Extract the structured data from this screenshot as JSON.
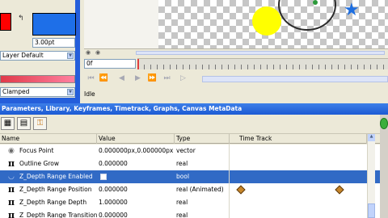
{
  "toolbox": {
    "outline_color": "#ff0000",
    "fill_color": "#1e6fe8",
    "swap_glyph": "↰",
    "width_value": "3.00pt",
    "layer_default": "Layer Default",
    "blend_method": "Clamped"
  },
  "canvas": {
    "circle_color": "#ffff00",
    "star_color": "#1f6fe0"
  },
  "timebar": {
    "time_value": "0f",
    "transport_buttons": [
      "⏮",
      "⏪",
      "◀",
      "▶",
      "⏩",
      "⏭",
      "▷"
    ],
    "status": "Idle"
  },
  "params_panel": {
    "title": "Parameters, Library, Keyframes, Timetrack, Graphs, Canvas MetaData",
    "headers": {
      "name": "Name",
      "value": "Value",
      "type": "Type",
      "time_track": "Time Track"
    },
    "rows": [
      {
        "icon": "◉",
        "name": "Focus Point",
        "value": "0.000000px,0.000000px",
        "type": "vector"
      },
      {
        "icon": "π",
        "name": "Outline Grow",
        "value": "0.000000",
        "type": "real"
      },
      {
        "icon": "◡",
        "name": "Z_Depth Range Enabled",
        "value": "",
        "type": "bool"
      },
      {
        "icon": "π",
        "name": "Z_Depth Range Position",
        "value": "0.000000",
        "type": "real (Animated)"
      },
      {
        "icon": "π",
        "name": "Z_Depth Range Depth",
        "value": "1.000000",
        "type": "real"
      },
      {
        "icon": "π",
        "name": "Z_Depth Range Transition",
        "value": "0.000000",
        "type": "real"
      }
    ],
    "keyframe_color": "#c7862a"
  }
}
